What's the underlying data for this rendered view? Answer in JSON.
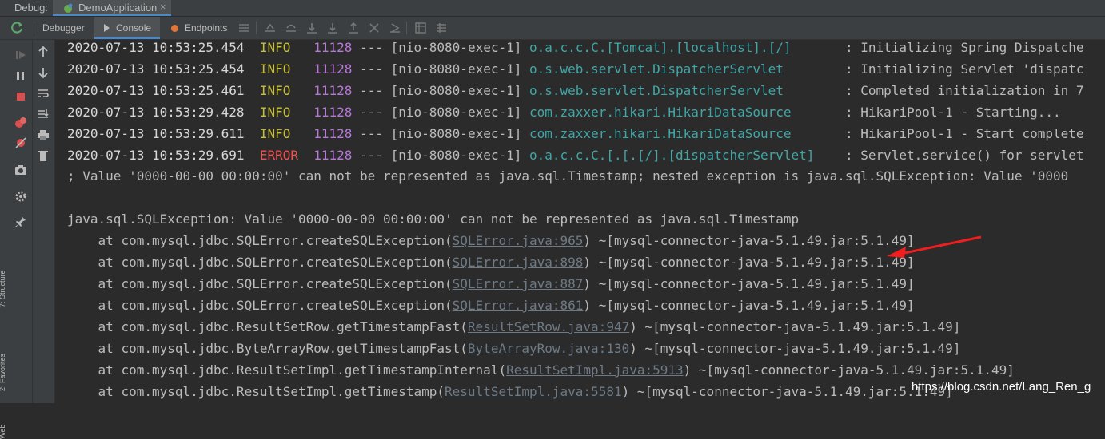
{
  "topbar": {
    "debug_label": "Debug:",
    "app_tab": "DemoApplication",
    "close": "×"
  },
  "toolbar": {
    "tabs": [
      "Debugger",
      "Console",
      "Endpoints"
    ]
  },
  "sidebar_labels": [
    "7: Structure",
    "2: Favorites",
    "Web"
  ],
  "colors": {
    "accent": "#4a88c7",
    "info": "#c6c03a",
    "error": "#f0524f",
    "pid": "#b877db",
    "logger": "#3fa7a7"
  },
  "log": [
    {
      "ts": "2020-07-13 10:53:25.454",
      "level": "INFO ",
      "pid": "11128",
      "sep": " --- ",
      "thread": "[nio-8080-exec-1] ",
      "logger": "o.a.c.c.C.[Tomcat].[localhost].[/]      ",
      "msg": " : Initializing Spring Dispatche"
    },
    {
      "ts": "2020-07-13 10:53:25.454",
      "level": "INFO ",
      "pid": "11128",
      "sep": " --- ",
      "thread": "[nio-8080-exec-1] ",
      "logger": "o.s.web.servlet.DispatcherServlet       ",
      "msg": " : Initializing Servlet 'dispatc"
    },
    {
      "ts": "2020-07-13 10:53:25.461",
      "level": "INFO ",
      "pid": "11128",
      "sep": " --- ",
      "thread": "[nio-8080-exec-1] ",
      "logger": "o.s.web.servlet.DispatcherServlet       ",
      "msg": " : Completed initialization in 7"
    },
    {
      "ts": "2020-07-13 10:53:29.428",
      "level": "INFO ",
      "pid": "11128",
      "sep": " --- ",
      "thread": "[nio-8080-exec-1] ",
      "logger": "com.zaxxer.hikari.HikariDataSource      ",
      "msg": " : HikariPool-1 - Starting..."
    },
    {
      "ts": "2020-07-13 10:53:29.611",
      "level": "INFO ",
      "pid": "11128",
      "sep": " --- ",
      "thread": "[nio-8080-exec-1] ",
      "logger": "com.zaxxer.hikari.HikariDataSource      ",
      "msg": " : HikariPool-1 - Start complete"
    },
    {
      "ts": "2020-07-13 10:53:29.691",
      "level": "ERROR",
      "pid": "11128",
      "sep": " --- ",
      "thread": "[nio-8080-exec-1] ",
      "logger": "o.a.c.c.C.[.[.[/].[dispatcherServlet]   ",
      "msg": " : Servlet.service() for servlet"
    }
  ],
  "nested_line": "; Value '0000-00-00 00:00:00' can not be represented as java.sql.Timestamp; nested exception is java.sql.SQLException: Value '0000",
  "exception_line": "java.sql.SQLException: Value '0000-00-00 00:00:00' can not be represented as java.sql.Timestamp",
  "stack": [
    {
      "method": "com.mysql.jdbc.SQLError.createSQLException",
      "file": "SQLError.java:965",
      "jar": "~[mysql-connector-java-5.1.49.jar:5.1.49]"
    },
    {
      "method": "com.mysql.jdbc.SQLError.createSQLException",
      "file": "SQLError.java:898",
      "jar": "~[mysql-connector-java-5.1.49.jar:5.1.49]"
    },
    {
      "method": "com.mysql.jdbc.SQLError.createSQLException",
      "file": "SQLError.java:887",
      "jar": "~[mysql-connector-java-5.1.49.jar:5.1.49]"
    },
    {
      "method": "com.mysql.jdbc.SQLError.createSQLException",
      "file": "SQLError.java:861",
      "jar": "~[mysql-connector-java-5.1.49.jar:5.1.49]"
    },
    {
      "method": "com.mysql.jdbc.ResultSetRow.getTimestampFast",
      "file": "ResultSetRow.java:947",
      "jar": "~[mysql-connector-java-5.1.49.jar:5.1.49]"
    },
    {
      "method": "com.mysql.jdbc.ByteArrayRow.getTimestampFast",
      "file": "ByteArrayRow.java:130",
      "jar": "~[mysql-connector-java-5.1.49.jar:5.1.49]"
    },
    {
      "method": "com.mysql.jdbc.ResultSetImpl.getTimestampInternal",
      "file": "ResultSetImpl.java:5913",
      "jar": "~[mysql-connector-java-5.1.49.jar:5.1.49]"
    },
    {
      "method": "com.mysql.jdbc.ResultSetImpl.getTimestamp",
      "file": "ResultSetImpl.java:5581",
      "jar": "~[mysql-connector-java-5.1.49.jar:5.1.49]"
    }
  ],
  "stack_prefix": "    at ",
  "watermark": "https://blog.csdn.net/Lang_Ren_g"
}
